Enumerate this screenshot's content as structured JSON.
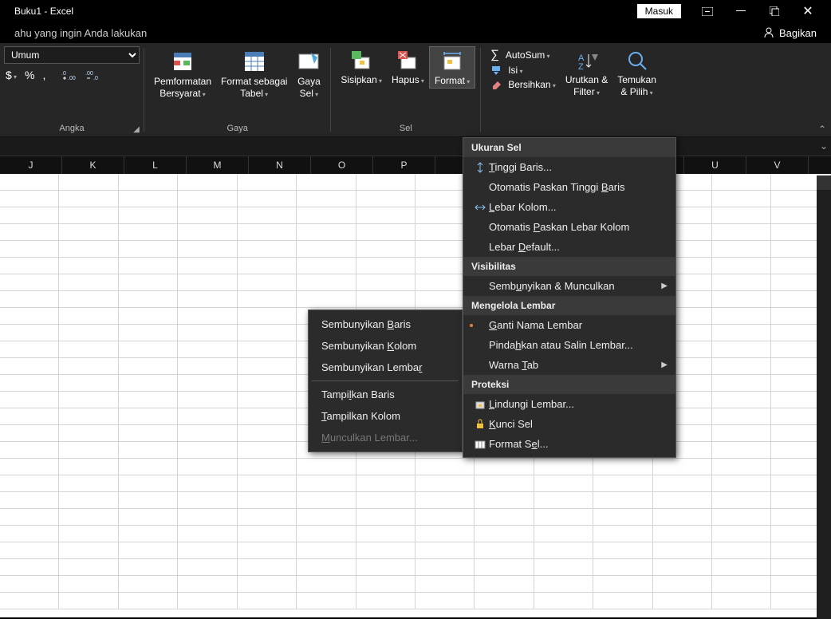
{
  "title": "Buku1  -  Excel",
  "signin": "Masuk",
  "tellme": "ahu yang ingin Anda lakukan",
  "share": "Bagikan",
  "ribbon": {
    "numfmt_select": "Umum",
    "sym_dollar": "$",
    "sym_percent": "%",
    "sym_comma": ",",
    "group_numfmt": "Angka",
    "cond": "Pemformatan\nBersyarat",
    "table": "Format sebagai\nTabel",
    "styles": "Gaya\nSel",
    "group_styles": "Gaya",
    "insert": "Sisipkan",
    "delete": "Hapus",
    "format": "Format",
    "group_cells": "Sel",
    "autosum": "AutoSum",
    "fill": "Isi",
    "clear": "Bersihkan",
    "sortfilter": "Urutkan &\nFilter",
    "find": "Temukan\n& Pilih"
  },
  "cols": [
    "J",
    "K",
    "L",
    "M",
    "N",
    "O",
    "P",
    "",
    "",
    "",
    "",
    "U",
    "V"
  ],
  "menu": {
    "h1": "Ukuran Sel",
    "rowheight": "Tinggi Baris...",
    "autofitrow": "Otomatis Paskan Tinggi Baris",
    "colwidth": "Lebar Kolom...",
    "autofitcol": "Otomatis Paskan Lebar Kolom",
    "default": "Lebar Default...",
    "h2": "Visibilitas",
    "hideunhide": "Sembunyikan & Munculkan",
    "h3": "Mengelola Lembar",
    "rename": "Ganti Nama Lembar",
    "move": "Pindahkan atau Salin Lembar...",
    "tabcolor": "Warna Tab",
    "h4": "Proteksi",
    "protect": "Lindungi Lembar...",
    "lock": "Kunci Sel",
    "formatcells": "Format Sel..."
  },
  "submenu": {
    "hiderow": "Sembunyikan Baris",
    "hidecol": "Sembunyikan Kolom",
    "hidesheet": "Sembunyikan Lembar",
    "showrow": "Tampilkan Baris",
    "showcol": "Tampilkan Kolom",
    "showsheet": "Munculkan Lembar..."
  }
}
